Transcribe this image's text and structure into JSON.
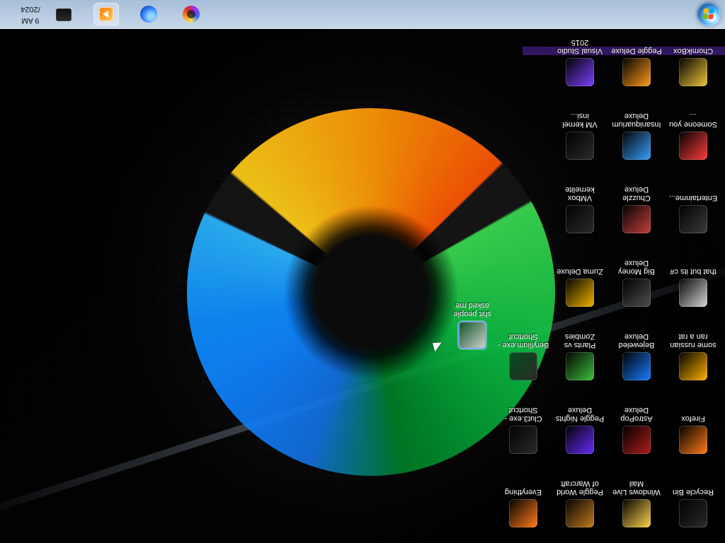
{
  "taskbar": {
    "clock": {
      "time": "9 AM",
      "date": "/2024"
    },
    "items": [
      {
        "icon": "firefox-icon"
      },
      {
        "icon": "blue-globe-icon"
      },
      {
        "icon": "media-player-icon"
      },
      {
        "icon": "printer-icon"
      }
    ]
  },
  "desktop": {
    "icons": [
      {
        "label": "Recycle Bin",
        "icon": "recycle-bin-icon",
        "color": "#2a2a2a"
      },
      {
        "label": "Firefox",
        "icon": "firefox-icon",
        "color": "#ff7a18"
      },
      {
        "label": "some russian ran a rat",
        "icon": "app-icon",
        "color": "#ffb100"
      },
      {
        "label": "that but its c#",
        "icon": "folder-icon",
        "color": "#d7d7d7"
      },
      {
        "label": "Entertainme...",
        "icon": "media-folder-icon",
        "color": "#3b3b3b"
      },
      {
        "label": "Someone you ...",
        "icon": "app-icon",
        "color": "#ff3b3b"
      },
      {
        "label": "ChomikBox",
        "icon": "app-icon",
        "color": "#eec63a"
      },
      {
        "label": "Windows Live Mail",
        "icon": "mail-icon",
        "color": "#ffd34d"
      },
      {
        "label": "AstroPop Deluxe",
        "icon": "game-icon",
        "color": "#b01b1b"
      },
      {
        "label": "Bejeweled Deluxe",
        "icon": "game-icon",
        "color": "#1a7cff"
      },
      {
        "label": "Big Money Deluxe",
        "icon": "game-icon",
        "color": "#4b4b4b"
      },
      {
        "label": "Chuzzle Deluxe",
        "icon": "game-icon",
        "color": "#c53f3f"
      },
      {
        "label": "Insaniquarium Deluxe",
        "icon": "game-icon",
        "color": "#3aa0ff"
      },
      {
        "label": "Peggle Deluxe",
        "icon": "game-icon",
        "color": "#ff9a1a"
      },
      {
        "label": "Peggle World of Warcraft",
        "icon": "game-icon",
        "color": "#c27a1f"
      },
      {
        "label": "Peggle Nights Deluxe",
        "icon": "game-icon",
        "color": "#6a2bff"
      },
      {
        "label": "Plants vs Zombies",
        "icon": "game-icon",
        "color": "#3fbf3f"
      },
      {
        "label": "Zuma Deluxe",
        "icon": "game-icon",
        "color": "#f1b400"
      },
      {
        "label": "VMbox kernelite",
        "icon": "vm-icon",
        "color": "#2b2b2b"
      },
      {
        "label": "VM kernel insi...",
        "icon": "vm-icon",
        "color": "#2b2b2b"
      },
      {
        "label": "Visual Studio 2015",
        "icon": "visual-studio-icon",
        "color": "#7b3fff"
      },
      {
        "label": "Everything",
        "icon": "app-icon",
        "color": "#ff7a18"
      },
      {
        "label": "Clut3.exe - Shortcut",
        "icon": "shortcut-icon",
        "color": "#2b2b2b"
      },
      {
        "label": "Beryllium.exe - Shortcut",
        "icon": "shortcut-icon",
        "color": "#2b2b2b"
      },
      {
        "label": "shit people asked me",
        "icon": "file-icon",
        "color": "#d8d8d8"
      }
    ]
  }
}
